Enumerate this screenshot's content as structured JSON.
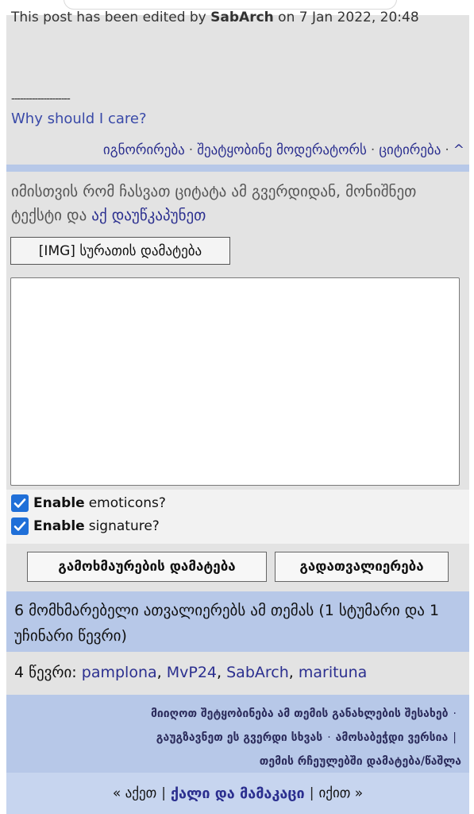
{
  "post": {
    "edited_prefix": "This post has been edited by ",
    "edited_user": "SabArch",
    "edited_suffix": " on 7 Jan 2022, 20:48",
    "signature_separator": "--------------------",
    "signature_link": "Why should I care?"
  },
  "actions": {
    "ignore": "იგნორირება",
    "report": "შეატყობინე მოდერატორს",
    "quote": "ციტირება",
    "top": "^",
    "separator": "·"
  },
  "reply": {
    "hint_text": "იმისთვის რომ ჩასვათ ციტატა ამ გვერდიდან, მონიშნეთ ტექსტი და",
    "hint_link": "აქ დაუწკაპუნეთ",
    "img_button": "[IMG] სურათის დამატება",
    "textarea_value": ""
  },
  "options": {
    "emoticons_bold": "Enable",
    "emoticons_rest": "emoticons?",
    "emoticons_checked": true,
    "signature_bold": "Enable",
    "signature_rest": "signature?",
    "signature_checked": true
  },
  "buttons": {
    "submit": "გამოხმაურების დამატება",
    "preview": "გადათვალიერება"
  },
  "viewers": {
    "text": "6 მომხმარებელი ათვალიერებს ამ თემას (1 სტუმარი და 1 უჩინარი წევრი)"
  },
  "online": {
    "prefix": "4 წევრი:",
    "users": [
      "pamplona",
      "MvP24",
      "SabArch",
      "marituna"
    ]
  },
  "topic_tools": {
    "notify": "მიიღოთ შეტყობინება ამ თემის განახლების შესახებ",
    "send": "გაუგზავნეთ ეს გვერდი სხვას",
    "print": "ამოსაბეჭდი ვერსია",
    "favorites": "თემის რჩეულებში დამატება/წაშლა",
    "dot": "·",
    "pipe": "|"
  },
  "nav": {
    "prev": "« აქეთ",
    "forum": "ქალი და მამაკაცი",
    "next": "იქით »",
    "pipe": "|"
  },
  "colors": {
    "link": "#2b2f8f",
    "panel_gray": "#e3e3e3",
    "panel_blue": "#b7c8e8",
    "checkbox": "#1f6fd8"
  }
}
